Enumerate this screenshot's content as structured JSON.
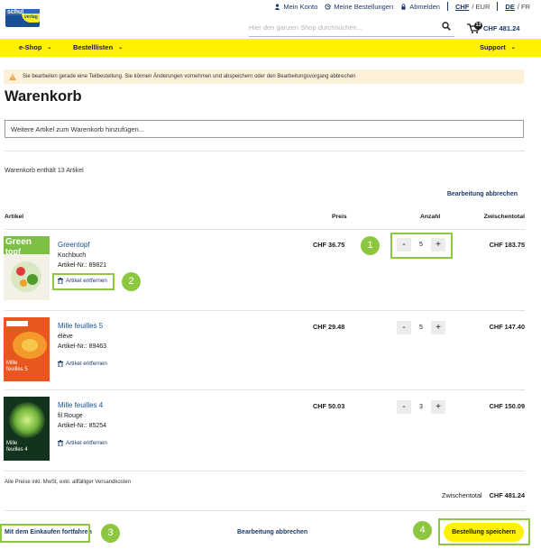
{
  "brand": {
    "line1": "schul",
    "line2": "verlag"
  },
  "topnav": {
    "account": "Mein Konto",
    "orders": "Meine Bestellungen",
    "logout": "Abmelden",
    "currency_active": "CHF",
    "currency_other": "/ EUR",
    "lang_active": "DE",
    "lang_other": "/ FR"
  },
  "search": {
    "placeholder": "Hier den ganzen Shop durchsuchen..."
  },
  "cart_mini": {
    "count": "13",
    "total": "CHF 481.24"
  },
  "menu": {
    "eshop": "e-Shop",
    "lists": "Bestelllisten",
    "support": "Support"
  },
  "notice": "Sie bearbeiten gerade eine Teilbestellung. Sie können Änderungen vornehmen und abspeichern oder den Bearbeitungsvorgang abbrechen",
  "page_title": "Warenkorb",
  "add_field": "Weitere Artikel zum Warenkorb hinzufügen...",
  "cart_count": "Warenkorb enthält 13 Artikel",
  "cancel_edit": "Bearbeitung abbrechen",
  "columns": {
    "article": "Artikel",
    "price": "Preis",
    "qty": "Anzahl",
    "subtotal": "Zwischentotal"
  },
  "items": [
    {
      "name": "Greentopf",
      "sub": "Kochbuch",
      "number": "Artikel-Nr.: 89821",
      "remove": "Artikel entfernen",
      "price": "CHF 36.75",
      "qty": "5",
      "subtotal": "CHF 183.75",
      "cover_title": "Green",
      "cover_title2": "topf"
    },
    {
      "name": "Mille feuilles 5",
      "sub": "élève",
      "number": "Artikel-Nr.: 89463",
      "remove": "Artikel entfernen",
      "price": "CHF 29.48",
      "qty": "5",
      "subtotal": "CHF 147.40",
      "cover_title": "Mille",
      "cover_title2": "feuilles 5"
    },
    {
      "name": "Mille feuilles 4",
      "sub": "fil Rouge",
      "number": "Artikel-Nr.: 85254",
      "remove": "Artikel entfernen",
      "price": "CHF 50.03",
      "qty": "3",
      "subtotal": "CHF 150.09",
      "cover_title": "Mille",
      "cover_title2": "feuilles 4"
    }
  ],
  "qty_minus": "-",
  "qty_plus": "+",
  "footnote": "Alle Preise inkl. MwSt, exkl. allfälliger Versandkosten",
  "grand_total": {
    "label": "Zwischentotal",
    "value": "CHF 481.24"
  },
  "actions": {
    "continue": "Mit dem Einkaufen fortfahren",
    "cancel": "Bearbeitung abbrechen",
    "save": "Bestellung speichern"
  },
  "callouts": [
    "1",
    "2",
    "3",
    "4"
  ],
  "colors": {
    "accent_yellow": "#fff200",
    "highlight_green": "#8dc63f",
    "link_blue": "#1b3a6b",
    "notice_bg": "#fdf1d9"
  }
}
